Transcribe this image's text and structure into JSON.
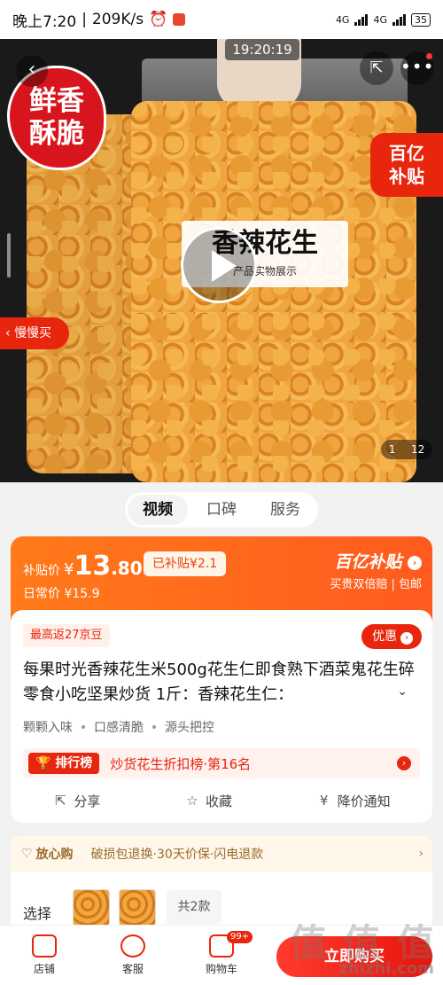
{
  "status_bar": {
    "time": "晚上7:20",
    "speed": "209K/s",
    "net1": "4G",
    "net2": "4G",
    "battery": "35"
  },
  "hero": {
    "video_time": "19:20:19",
    "badge_line1": "鲜香",
    "badge_line2": "酥脆",
    "subsidy_line1": "百亿",
    "subsidy_line2": "补贴",
    "video_title": "香辣花生",
    "video_subtitle": "产品实物展示",
    "slow_buy": "慢慢买",
    "image_index": "1",
    "image_total": "12"
  },
  "tabs": [
    "视频",
    "口碑",
    "服务"
  ],
  "price": {
    "label": "补贴价",
    "currency": "¥",
    "integer": "13",
    "decimal": ".80",
    "subsidy_tag": "已补贴¥2.1",
    "daily_label": "日常价",
    "daily_price": "¥15.9",
    "program": "百亿补贴",
    "program_sub": "买贵双倍赔 | 包邮"
  },
  "product": {
    "bean": "最高返27京豆",
    "coupon": "优惠",
    "title": "每果时光香辣花生米500g花生仁即食熟下酒菜鬼花生碎零食小吃坚果炒货 1斤：香辣花生仁：",
    "features": [
      "颗颗入味",
      "口感清脆",
      "源头把控"
    ],
    "rank_tag": "排行榜",
    "rank_text": "炒货花生折扣榜·第16名",
    "actions": {
      "share": "分享",
      "favorite": "收藏",
      "notify": "降价通知"
    }
  },
  "assurance": {
    "name": "放心购",
    "text": "破损包退换·30天价保·闪电退款"
  },
  "selection": {
    "label": "选择",
    "count": "共2款"
  },
  "bottom_bar": {
    "store": "店铺",
    "service": "客服",
    "cart": "购物车",
    "cart_badge": "99+",
    "buy": "立即购买"
  },
  "watermark": {
    "text": "值 值 值",
    "url": "zhizhi.com"
  },
  "colors": {
    "brand_red": "#e8250d",
    "brand_orange": "#ff7a1a"
  }
}
